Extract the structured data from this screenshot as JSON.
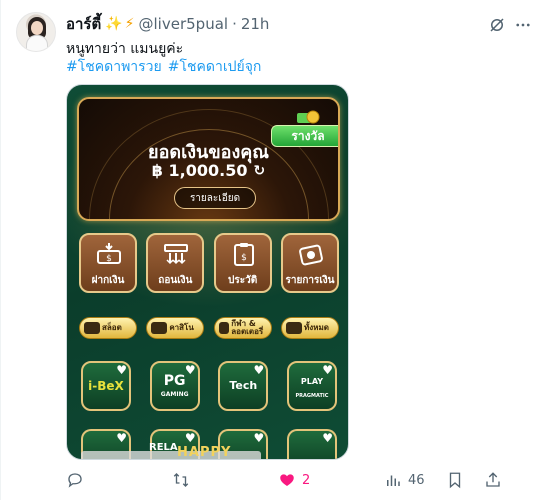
{
  "author": {
    "name": "อาร์ตี้",
    "emojis": [
      "✨",
      "⚡"
    ],
    "handle": "@liver5pual",
    "separator": "·",
    "time": "21h"
  },
  "tweet": {
    "text": "หนูทายว่า แมนยูค่ะ",
    "hashtags": [
      "#โชคดาพารวย",
      "#โชคดาเปย์จุก"
    ]
  },
  "media": {
    "balance_title": "ยอดเงินของคุณ",
    "balance_amount": "฿ 1,000.50",
    "details_button": "รายละเอียด",
    "reward_badge": "รางวัล",
    "menu": [
      {
        "label": "ฝากเงิน",
        "icon": "deposit-icon"
      },
      {
        "label": "ถอนเงิน",
        "icon": "withdraw-icon"
      },
      {
        "label": "ประวัติ",
        "icon": "history-icon"
      },
      {
        "label": "รายการเงิน",
        "icon": "transactions-icon"
      }
    ],
    "categories": [
      {
        "label": "สล็อต"
      },
      {
        "label": "คาสิโน"
      },
      {
        "label": "กีฬา & ลอตเตอรี่"
      },
      {
        "label": "ทั้งหมด"
      }
    ],
    "games": [
      {
        "logo": "i-BeX",
        "color": "#e8e23c"
      },
      {
        "logo": "PG",
        "sub": "GAMING",
        "color": "#ffffff"
      },
      {
        "logo": "Tech",
        "color": "#ffffff"
      },
      {
        "logo": "PLAY",
        "sub": "PRAGMATIC",
        "color": "#ffffff"
      }
    ],
    "banner_text": "HAPPY",
    "relax_text": "RELA"
  },
  "actions": {
    "reply_count": "",
    "retweet_count": "",
    "like_count": "2",
    "views_count": "46"
  },
  "colors": {
    "link": "#1d9bf0",
    "muted": "#536471",
    "like": "#f91880",
    "media_green": "#0f4d36",
    "gold": "#d8a956"
  }
}
